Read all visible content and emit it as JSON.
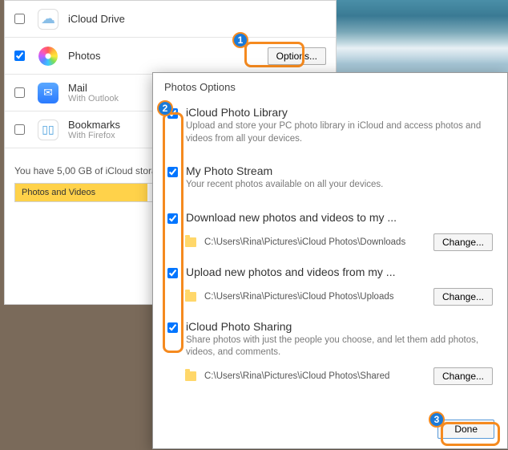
{
  "services": [
    {
      "title": "iCloud Drive",
      "sub": "",
      "checked": false,
      "has_options": false
    },
    {
      "title": "Photos",
      "sub": "",
      "checked": true,
      "has_options": true,
      "options_label": "Options..."
    },
    {
      "title": "Mail",
      "sub": "With Outlook",
      "checked": false,
      "has_options": false
    },
    {
      "title": "Bookmarks",
      "sub": "With Firefox",
      "checked": false,
      "has_options": false
    }
  ],
  "storage": {
    "label": "You have 5,00 GB of iCloud stora",
    "segment": "Photos and Videos"
  },
  "dialog": {
    "title": "Photos Options",
    "done_label": "Done",
    "change_label": "Change...",
    "options": [
      {
        "title": "iCloud Photo Library",
        "desc": "Upload and store your PC photo library in iCloud and access photos and videos from all your devices.",
        "path": ""
      },
      {
        "title": "My Photo Stream",
        "desc": "Your recent photos available on all your devices.",
        "path": ""
      },
      {
        "title": "Download new photos and videos to my ...",
        "desc": "",
        "path": "C:\\Users\\Rina\\Pictures\\iCloud Photos\\Downloads"
      },
      {
        "title": "Upload new photos and videos from my ...",
        "desc": "",
        "path": "C:\\Users\\Rina\\Pictures\\iCloud Photos\\Uploads"
      },
      {
        "title": "iCloud Photo Sharing",
        "desc": "Share photos with just the people you choose, and let them add photos, videos, and comments.",
        "path": "C:\\Users\\Rina\\Pictures\\iCloud Photos\\Shared"
      }
    ]
  },
  "callouts": {
    "one": "1",
    "two": "2",
    "three": "3"
  }
}
